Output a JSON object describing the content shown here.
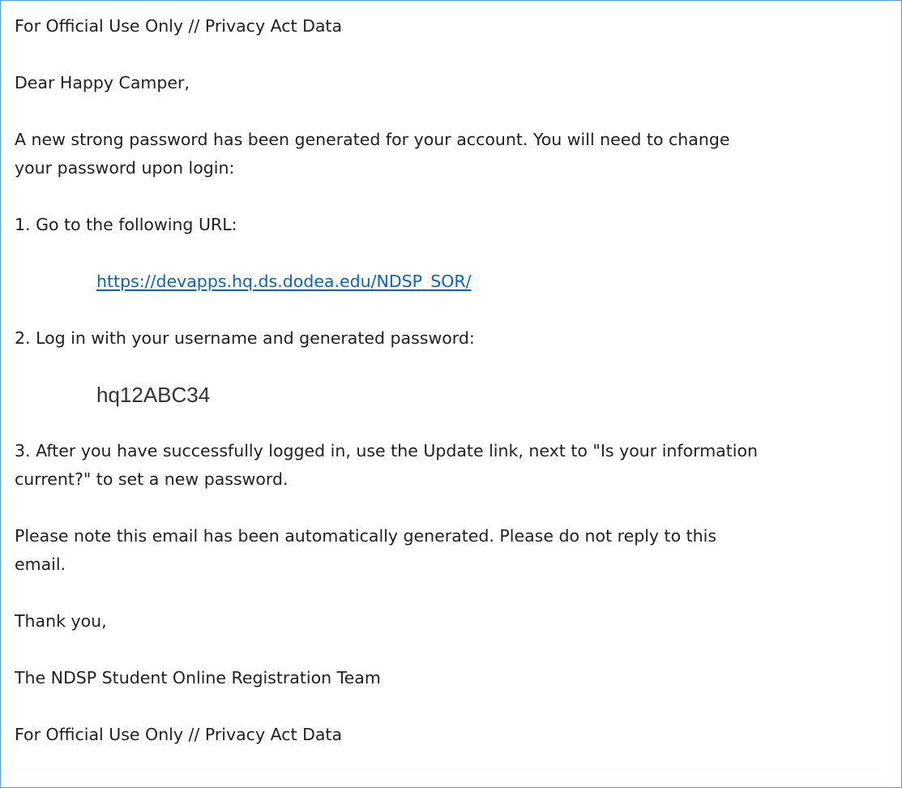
{
  "email": {
    "header_banner": "For Official Use Only // Privacy Act Data",
    "greeting": "Dear Happy Camper,",
    "intro_line_1": "A new strong password has been generated for your account. You will need to change",
    "intro_line_2": "your password upon login:",
    "step_1": "1. Go to the following URL:",
    "url": "https://devapps.hq.ds.dodea.edu/NDSP_SOR/",
    "step_2": "2. Log in with your username and generated password:",
    "password": "hq12ABC34",
    "step_3_line_1": "3. After you have successfully logged in, use the Update link, next to \"Is your information",
    "step_3_line_2": "current?\" to set a new password.",
    "note_line_1": "Please note this email has been automatically generated. Please do not reply to this",
    "note_line_2": "email.",
    "closing": "Thank you,",
    "signature": "The NDSP Student Online Registration Team",
    "footer_banner": "For Official Use Only // Privacy Act Data"
  },
  "colors": {
    "frame_border": "#5b9bd5",
    "link": "#0563c1",
    "text": "#1f1f1f"
  }
}
